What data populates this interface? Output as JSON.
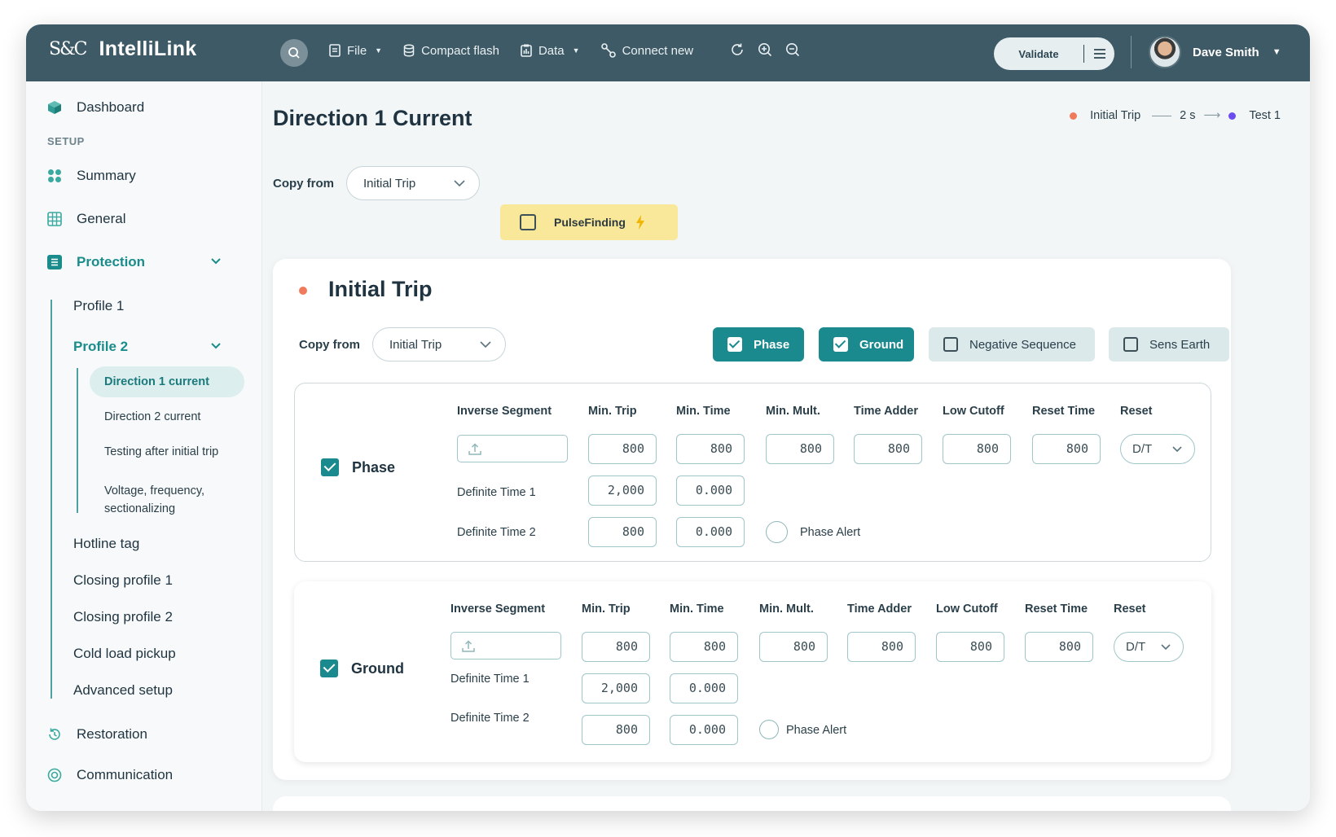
{
  "app": {
    "logo_mark": "S&C",
    "name": "IntelliLink"
  },
  "topbar": {
    "menu": [
      {
        "label": "File",
        "icon": "file-icon",
        "has_dropdown": true
      },
      {
        "label": "Compact flash",
        "icon": "database-icon",
        "has_dropdown": false
      },
      {
        "label": "Data",
        "icon": "data-icon",
        "has_dropdown": true
      },
      {
        "label": "Connect new",
        "icon": "connect-icon",
        "has_dropdown": false
      }
    ],
    "validate_label": "Validate",
    "user_name": "Dave Smith"
  },
  "sidebar": {
    "dashboard": "Dashboard",
    "section_setup": "SETUP",
    "summary": "Summary",
    "general": "General",
    "protection": "Protection",
    "profile1": "Profile 1",
    "profile2": "Profile 2",
    "sub": {
      "dir1": "Direction 1 current",
      "dir2": "Direction 2 current",
      "testing": "Testing after initial trip",
      "voltage_line1": "Voltage, frequency,",
      "voltage_line2": "sectionalizing"
    },
    "hotline": "Hotline tag",
    "closing1": "Closing profile 1",
    "closing2": "Closing profile 2",
    "cold": "Cold load pickup",
    "advanced": "Advanced setup",
    "restoration": "Restoration",
    "communication": "Communication"
  },
  "page": {
    "title": "Direction 1 Current",
    "timeline": {
      "from": "Initial Trip",
      "delay": "2 s",
      "to": "Test 1",
      "from_color": "#f07b5c",
      "to_color": "#6b4cf0"
    },
    "copy_from_label": "Copy from",
    "copy_from_value": "Initial Trip",
    "pulse_label": "PulseFinding"
  },
  "card": {
    "title": "Initial Trip",
    "copy_from_label": "Copy from",
    "copy_from_value": "Initial Trip",
    "toggles": {
      "phase": "Phase",
      "ground": "Ground",
      "negative": "Negative Sequence",
      "sens": "Sens Earth"
    }
  },
  "columns": [
    "Inverse Segment",
    "Min. Trip",
    "Min. Time",
    "Min. Mult.",
    "Time Adder",
    "Low Cutoff",
    "Reset Time",
    "Reset"
  ],
  "phase": {
    "label": "Phase",
    "row1": [
      "800",
      "800",
      "800",
      "800",
      "800",
      "800"
    ],
    "reset": "D/T",
    "dt1_label": "Definite Time 1",
    "dt1": [
      "2,000",
      "0.000"
    ],
    "dt2_label": "Definite Time 2",
    "dt2": [
      "800",
      "0.000"
    ],
    "alert": "Phase Alert"
  },
  "ground": {
    "label": "Ground",
    "row1": [
      "800",
      "800",
      "800",
      "800",
      "800",
      "800"
    ],
    "reset": "D/T",
    "dt1_label": "Definite Time 1",
    "dt1": [
      "2,000",
      "0.000"
    ],
    "dt2_label": "Definite Time 2",
    "dt2": [
      "800",
      "0.000"
    ],
    "alert": "Phase Alert"
  }
}
